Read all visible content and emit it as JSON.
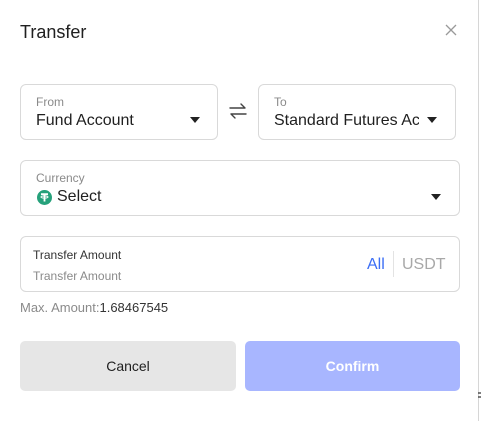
{
  "dialog": {
    "title": "Transfer"
  },
  "from": {
    "label": "From",
    "value": "Fund Account"
  },
  "to": {
    "label": "To",
    "value": "Standard Futures Account"
  },
  "currency": {
    "label": "Currency",
    "value": "Select",
    "coin_icon": "tether-icon",
    "coin_color": "#26a17b"
  },
  "amount": {
    "label": "Transfer Amount",
    "placeholder": "Transfer Amount",
    "all_label": "All",
    "unit": "USDT"
  },
  "max_amount": {
    "label": "Max. Amount:",
    "value": "1.68467545"
  },
  "buttons": {
    "cancel": "Cancel",
    "confirm": "Confirm"
  },
  "colors": {
    "accent": "#3b6ef5",
    "confirm_bg": "#a8b6ff",
    "cancel_bg": "#e6e6e6"
  }
}
